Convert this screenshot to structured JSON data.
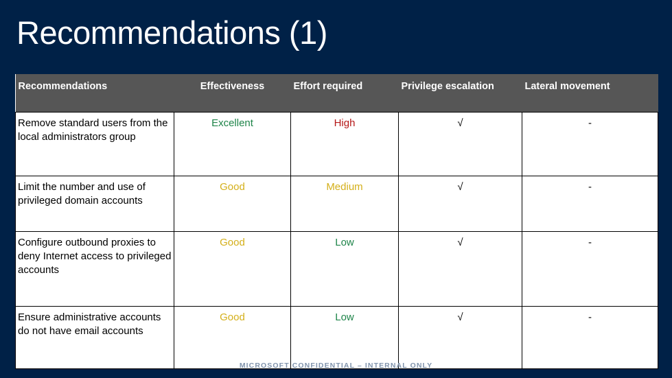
{
  "slide": {
    "title": "Recommendations (1)",
    "background_color": "#002147",
    "footer": "MICROSOFT CONFIDENTIAL – INTERNAL ONLY"
  },
  "table": {
    "header_background": "#565656",
    "headers": [
      "Recommendations",
      "Effectiveness",
      "Effort required",
      "Privilege escalation",
      "Lateral movement"
    ],
    "rows": [
      {
        "recommendation": "Remove standard users from the local administrators group",
        "effectiveness": "Excellent",
        "effectiveness_color": "#1e8449",
        "effort": "High",
        "effort_color": "#b51717",
        "privilege_escalation": "√",
        "lateral_movement": "-"
      },
      {
        "recommendation": "Limit the number and use of privileged domain accounts",
        "effectiveness": "Good",
        "effectiveness_color": "#d4af19",
        "effort": "Medium",
        "effort_color": "#d4af19",
        "privilege_escalation": "√",
        "lateral_movement": "-"
      },
      {
        "recommendation": "Configure outbound proxies to deny Internet access to privileged accounts",
        "effectiveness": "Good",
        "effectiveness_color": "#d4af19",
        "effort": "Low",
        "effort_color": "#1e8449",
        "privilege_escalation": "√",
        "lateral_movement": "-"
      },
      {
        "recommendation": "Ensure administrative accounts do not have email accounts",
        "effectiveness": "Good",
        "effectiveness_color": "#d4af19",
        "effort": "Low",
        "effort_color": "#1e8449",
        "privilege_escalation": "√",
        "lateral_movement": "-"
      }
    ]
  }
}
